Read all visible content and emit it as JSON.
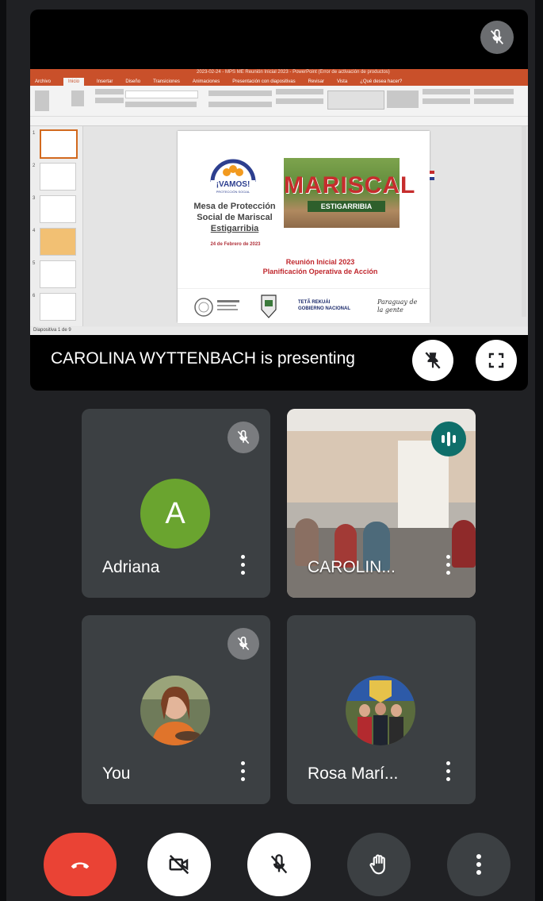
{
  "presentation": {
    "presenter_label": "CAROLINA WYTTENBACH is presenting",
    "ppt_window_title": "2023-02-24 - MPS ME Reunión Inicial 2023 - PowerPoint (Error de activación de productos)",
    "ppt_tabs": [
      "Archivo",
      "Inicio",
      "Insertar",
      "Diseño",
      "Transiciones",
      "Animaciones",
      "Presentación con diapositivas",
      "Revisar",
      "Vista",
      "¿Qué desea hacer?"
    ],
    "ppt_status": "Diapositiva 1 de 9",
    "thumb_numbers": [
      "1",
      "2",
      "3",
      "4",
      "5",
      "6"
    ],
    "slide": {
      "logo_text": "¡VAMOS!",
      "logo_sub": "PROTECCIÓN SOCIAL",
      "title_line1": "Mesa de Protección",
      "title_line2": "Social de Mariscal",
      "title_line3": "Estigarribia",
      "date": "24 de Febrero de 2023",
      "subtitle_line1": "Reunión Inicial 2023",
      "subtitle_line2": "Planificación Operativa de Acción",
      "sign_big": "MARISCAL",
      "sign_small": "ESTIGARRIBIA",
      "footer_gov_line1": "TETÃ REKUÁI",
      "footer_gov_line2": "GOBIERNO NACIONAL",
      "footer_slogan": "Paraguay de la gente"
    }
  },
  "participants": [
    {
      "name": "Adriana",
      "avatar_letter": "A",
      "avatar_color": "#6aa42f",
      "muted": true
    },
    {
      "name": "CAROLIN...",
      "speaking": true
    },
    {
      "name": "You",
      "muted": true
    },
    {
      "name": "Rosa Marí..."
    }
  ],
  "controls": {
    "leave_color": "#ea4335",
    "icons": [
      "phone-hangup-icon",
      "camera-off-icon",
      "mic-off-icon",
      "raise-hand-icon",
      "more-options-icon"
    ]
  }
}
